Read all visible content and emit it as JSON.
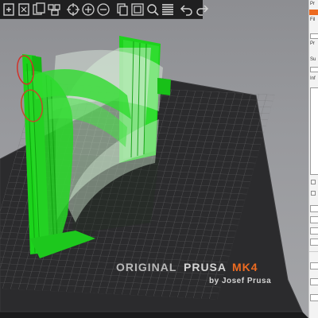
{
  "app": {
    "accent": "#ed6b21",
    "model_color": "#1bd31b"
  },
  "toolbar": {
    "buttons": [
      {
        "name": "add-icon"
      },
      {
        "name": "delete-icon"
      },
      {
        "name": "delete-all-icon"
      },
      {
        "name": "arrange-icon"
      },
      {
        "name": "copy-icon"
      },
      {
        "name": "paste-icon"
      },
      {
        "name": "add-instance-icon"
      },
      {
        "name": "remove-instance-icon"
      },
      {
        "name": "split-objects-icon"
      },
      {
        "name": "split-parts-icon"
      },
      {
        "name": "layer-editing-icon"
      },
      {
        "name": "undo-icon"
      },
      {
        "name": "redo-icon"
      }
    ]
  },
  "bed": {
    "brand_line1": "ORIGINAL",
    "brand_line2": "PRUSA",
    "brand_model": "MK4",
    "brand_line3": "by Josef Prusa",
    "brand_colors": {
      "original": "#b9b9b9",
      "prusa": "#d4d4d4",
      "mk4": "#ed6b21",
      "byline": "#d4d4d4"
    }
  },
  "sidebar": {
    "labels": [
      "Pr",
      "Fil",
      "Pr",
      "Su",
      "Inf"
    ]
  }
}
